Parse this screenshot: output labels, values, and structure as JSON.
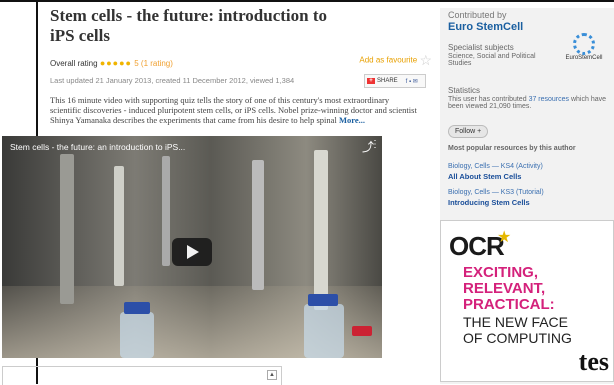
{
  "main": {
    "title": "Stem cells - the future: introduction to iPS cells",
    "rating_label": "Overall rating",
    "rating_dots": "●●●●●",
    "rating_value": "5 (1 rating)",
    "add_favourite": "Add as favourite",
    "share_label": "SHARE",
    "updated": "Last updated 21 January 2013, created 11 December 2012, viewed 1,384",
    "description": "This 16 minute video with supporting quiz tells the story of one of this century's most extraordinary scientific discoveries - induced pluripotent stem cells, or iPS cells. Nobel prize-winning doctor and scientist Shinya Yamanaka describes the experiments that came from his desire to help spinal",
    "more": "More...",
    "video_title": "Stem cells - the future: an introduction to iPS..."
  },
  "sidebar": {
    "contributed_by": "Contributed by",
    "author": "Euro StemCell",
    "logo_text": "EuroStemCell",
    "specialist_label": "Specialist subjects",
    "specialist_value": "Science, Social and Political Studies",
    "statistics_label": "Statistics",
    "stats_prefix": "This user has contributed",
    "stats_link": "37 resources",
    "stats_suffix": "which have been viewed 21,090 times.",
    "follow": "Follow +",
    "popular_label": "Most popular resources by this author",
    "res1_meta": "Biology, Cells — KS4 (Activity)",
    "res1_title": "All About Stem Cells",
    "res2_meta": "Biology, Cells — KS3 (Tutorial)",
    "res2_title": "Introducing Stem Cells"
  },
  "ad": {
    "brand": "OCR",
    "line1": "EXCITING,",
    "line2": "RELEVANT,",
    "line3": "PRACTICAL:",
    "line4": "THE NEW FACE",
    "line5": "OF COMPUTING",
    "logo": "tes"
  },
  "colors": {
    "link": "#1a5fa0",
    "rating": "#f0b400",
    "ad_accent": "#d4217b"
  }
}
